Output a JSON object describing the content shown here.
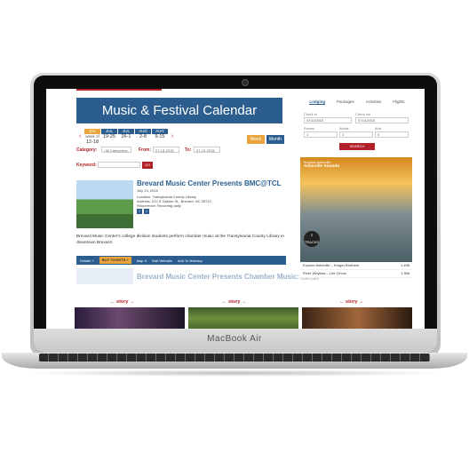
{
  "laptop": {
    "brand": "MacBook Air"
  },
  "page": {
    "title": "Music & Festival Calendar"
  },
  "dates": [
    {
      "month": "JUL",
      "day": "week of",
      "date": "12-18",
      "selected": true
    },
    {
      "month": "JUL",
      "day": "",
      "date": "19-25",
      "selected": false
    },
    {
      "month": "JUL",
      "day": "",
      "date": "26-1",
      "selected": false
    },
    {
      "month": "AUG",
      "day": "",
      "date": "2-8",
      "selected": false
    },
    {
      "month": "AUG",
      "day": "",
      "date": "9-15",
      "selected": false
    }
  ],
  "view_toggle": {
    "week": "Week",
    "month": "Month"
  },
  "filters": {
    "category_label": "Category:",
    "category_value": "-All Categories-",
    "from_label": "From:",
    "from_value": "07-13-2015",
    "to_label": "To:",
    "to_value": "07-19-2015",
    "keyword_label": "Keyword:",
    "go": "GO"
  },
  "event": {
    "title": "Brevard Music Center Presents BMC@TCL",
    "date": "July 13, 2015",
    "location": "Location: Transylvania County Library",
    "address": "Address: 212 S Gaston St., Brevard, NC 28712",
    "recurrence": "Recurrence: Recurring daily",
    "description": "Brevard Music Center's college division students perform chamber music at the Transylvania County Library in downtown Brevard.",
    "actions": [
      "Details +",
      "BUY TICKETS +",
      "Map It",
      "Visit Website",
      "Add To Itinerary"
    ]
  },
  "event2": {
    "title": "Brevard Music Center Presents Chamber Music:"
  },
  "sidebar": {
    "tabs": [
      "Lodging",
      "Packages",
      "Activities",
      "Flights"
    ],
    "check_in_label": "Check in",
    "check_in": "07/13/2015",
    "check_out_label": "Check out",
    "check_out": "07/14/2015",
    "rooms_label": "Rooms",
    "rooms": "1",
    "adults_label": "Adults",
    "adults": "1",
    "kids_label": "Kids",
    "kids": "0",
    "search": "SEARCH"
  },
  "soundcloud": {
    "account": "Explore Asheville",
    "playlist": "Asheville Sounds",
    "track_count": "2",
    "track_label": "TRACKS",
    "tracks": [
      {
        "name": "Explore Asheville – Kruger Brothers",
        "plays": "1,498"
      },
      {
        "name": "River Whyless – Life Circus",
        "plays": "1,398"
      }
    ],
    "cookie": "Cookie policy"
  },
  "stories": [
    "← story →",
    "← story →",
    "← story →"
  ],
  "colors": {
    "primary": "#2b5e8f",
    "accent": "#b22028",
    "highlight": "#e9a53b"
  }
}
